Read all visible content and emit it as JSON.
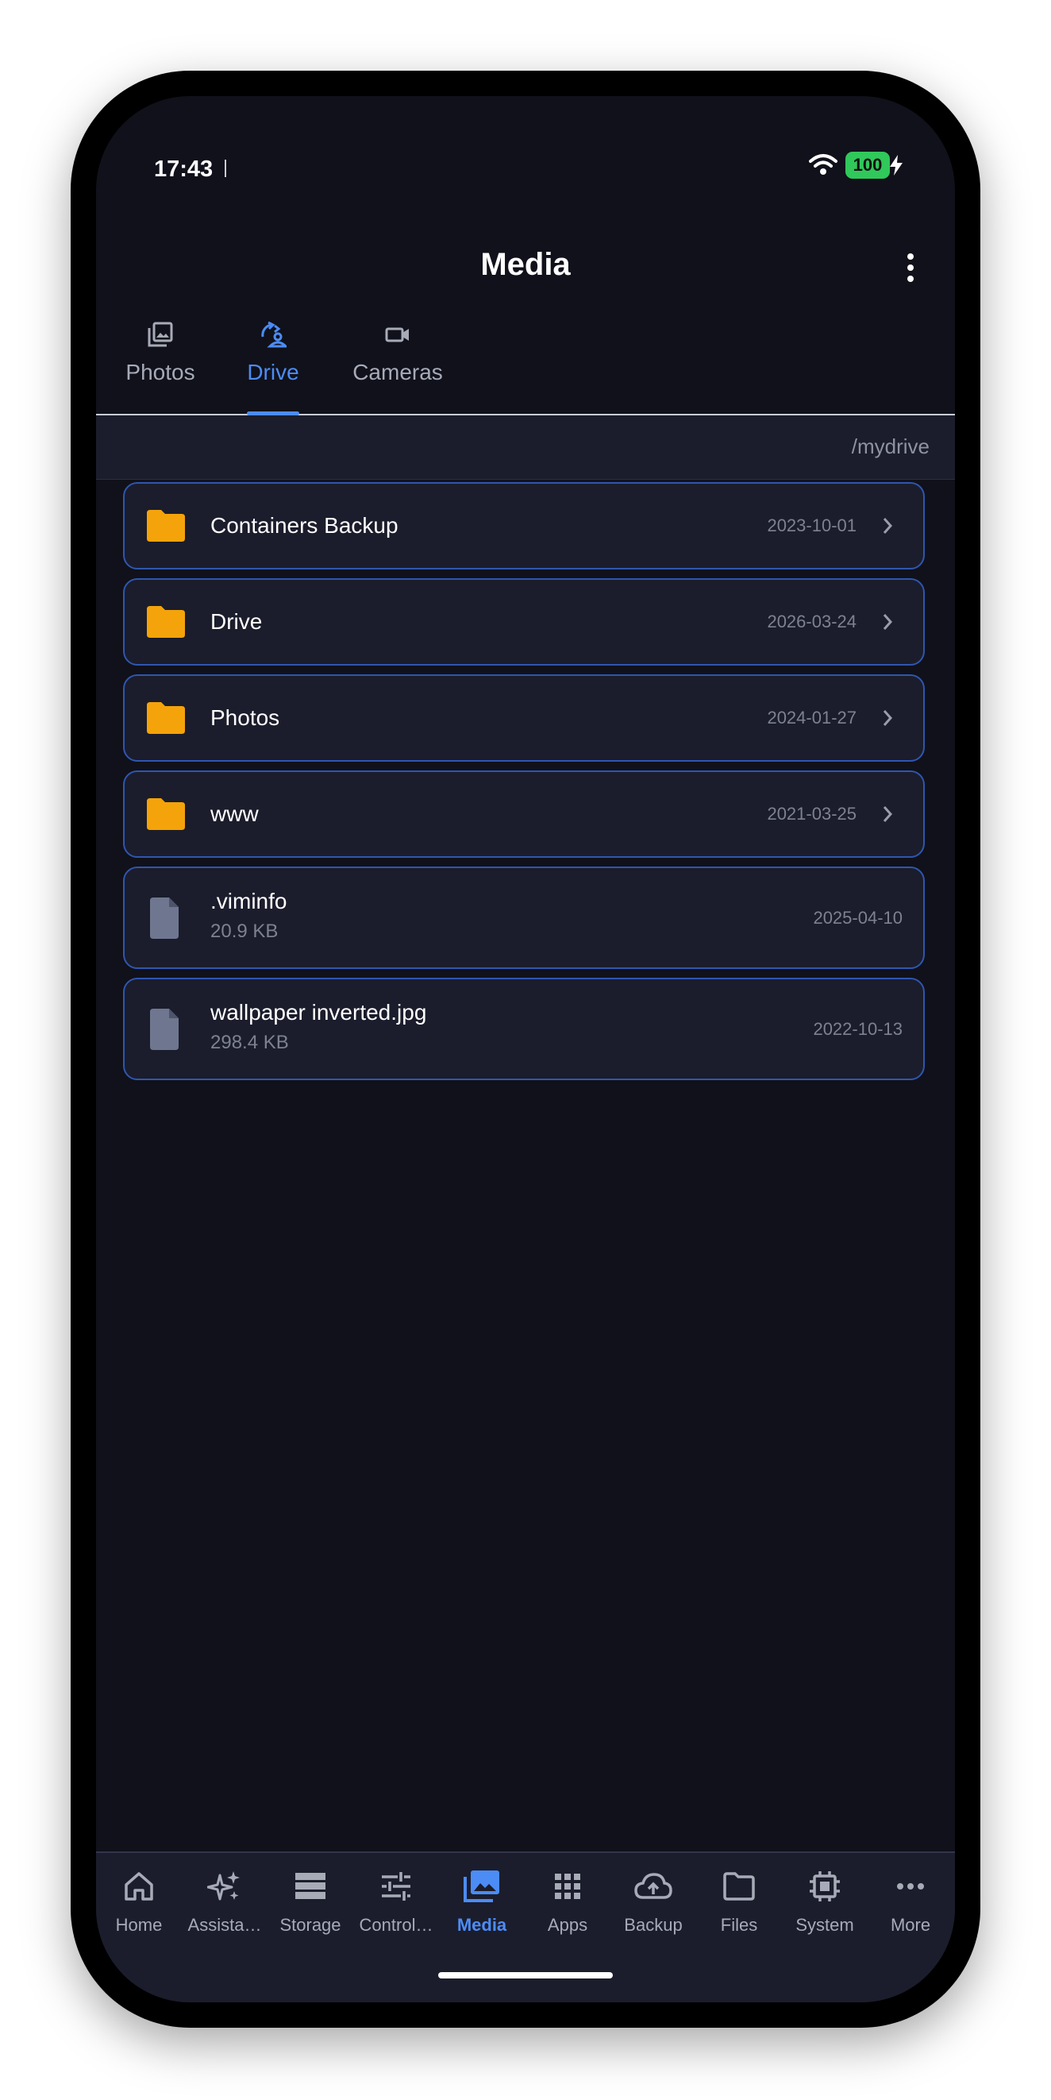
{
  "status_bar": {
    "time": "17:43",
    "battery": "100"
  },
  "header": {
    "title": "Media"
  },
  "tabs": [
    {
      "label": "Photos",
      "icon": "photo-library-icon",
      "active": false
    },
    {
      "label": "Drive",
      "icon": "drive-sync-icon",
      "active": true
    },
    {
      "label": "Cameras",
      "icon": "video-camera-icon",
      "active": false
    }
  ],
  "path": "/mydrive",
  "items": [
    {
      "type": "folder",
      "name": "Containers Backup",
      "date": "2023-10-01"
    },
    {
      "type": "folder",
      "name": "Drive",
      "date": "2026-03-24"
    },
    {
      "type": "folder",
      "name": "Photos",
      "date": "2024-01-27"
    },
    {
      "type": "folder",
      "name": "www",
      "date": "2021-03-25"
    },
    {
      "type": "file",
      "name": ".viminfo",
      "size": "20.9 KB",
      "date": "2025-04-10"
    },
    {
      "type": "file",
      "name": "wallpaper inverted.jpg",
      "size": "298.4 KB",
      "date": "2022-10-13"
    }
  ],
  "bottom_nav": [
    {
      "label": "Home",
      "icon": "home-icon"
    },
    {
      "label": "Assista…",
      "icon": "sparkles-icon"
    },
    {
      "label": "Storage",
      "icon": "storage-icon"
    },
    {
      "label": "Control…",
      "icon": "sliders-icon"
    },
    {
      "label": "Media",
      "icon": "photo-library-icon",
      "active": true
    },
    {
      "label": "Apps",
      "icon": "apps-grid-icon"
    },
    {
      "label": "Backup",
      "icon": "cloud-upload-icon"
    },
    {
      "label": "Files",
      "icon": "folder-icon"
    },
    {
      "label": "System",
      "icon": "chip-icon"
    },
    {
      "label": "More",
      "icon": "more-horizontal-icon"
    }
  ],
  "colors": {
    "background": "#10111a",
    "surface": "#1b1d2c",
    "accent": "#4c8cf5",
    "folder": "#f5a30a",
    "card_border": "#2f56b0",
    "battery": "#30c85a"
  }
}
